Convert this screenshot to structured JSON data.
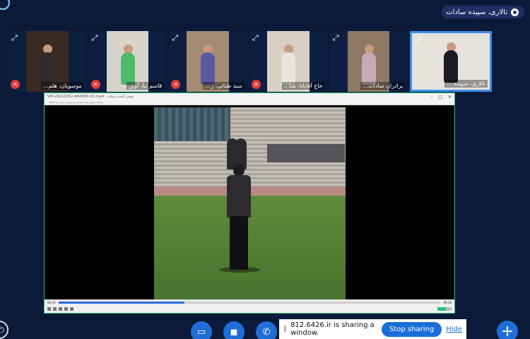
{
  "presenter": {
    "name": "تالاری، سپیده سادات"
  },
  "participants": [
    {
      "name": "موسویان، هلم...",
      "muted": true,
      "bg": "#3a2a24",
      "shirt": "#2d2a2a"
    },
    {
      "name": "قاسم نیا، آوین",
      "muted": true,
      "bg": "#d7d4cc",
      "shirt": "#4fb86a"
    },
    {
      "name": "سید طباتی، ر...",
      "muted": true,
      "bg": "#a38b74",
      "shirt": "#5b5aa0"
    },
    {
      "name": "حاج آقابابا، شا...",
      "muted": true,
      "bg": "#d8cfc5",
      "shirt": "#e8e6dc"
    },
    {
      "name": "برادران سادات...",
      "muted": false,
      "bg": "#8e7866",
      "shirt": "#c9a8b8"
    },
    {
      "name": "تالاری، سپیده ...",
      "muted": false,
      "bg": "#e6e2dc",
      "shirt": "#1b1b24"
    }
  ],
  "player": {
    "title": "VID-20210302-WA0000-(2).mp4 - پخش کننده رسانه",
    "menu": "رسانه  پخش  صدا  ویدئو  زیرنویس  ابزار  نما  کمک",
    "time_elapsed": "00:23",
    "time_total": "00:38",
    "progress": 0.33
  },
  "toolbar": {
    "screen_icon": "▭",
    "camera_icon": "◼",
    "phone_icon": "✆",
    "plus_icon": "+"
  },
  "share_notice": {
    "text": "812.6426.ir is sharing a window.",
    "stop_label": "Stop sharing",
    "hide_label": "Hide"
  }
}
